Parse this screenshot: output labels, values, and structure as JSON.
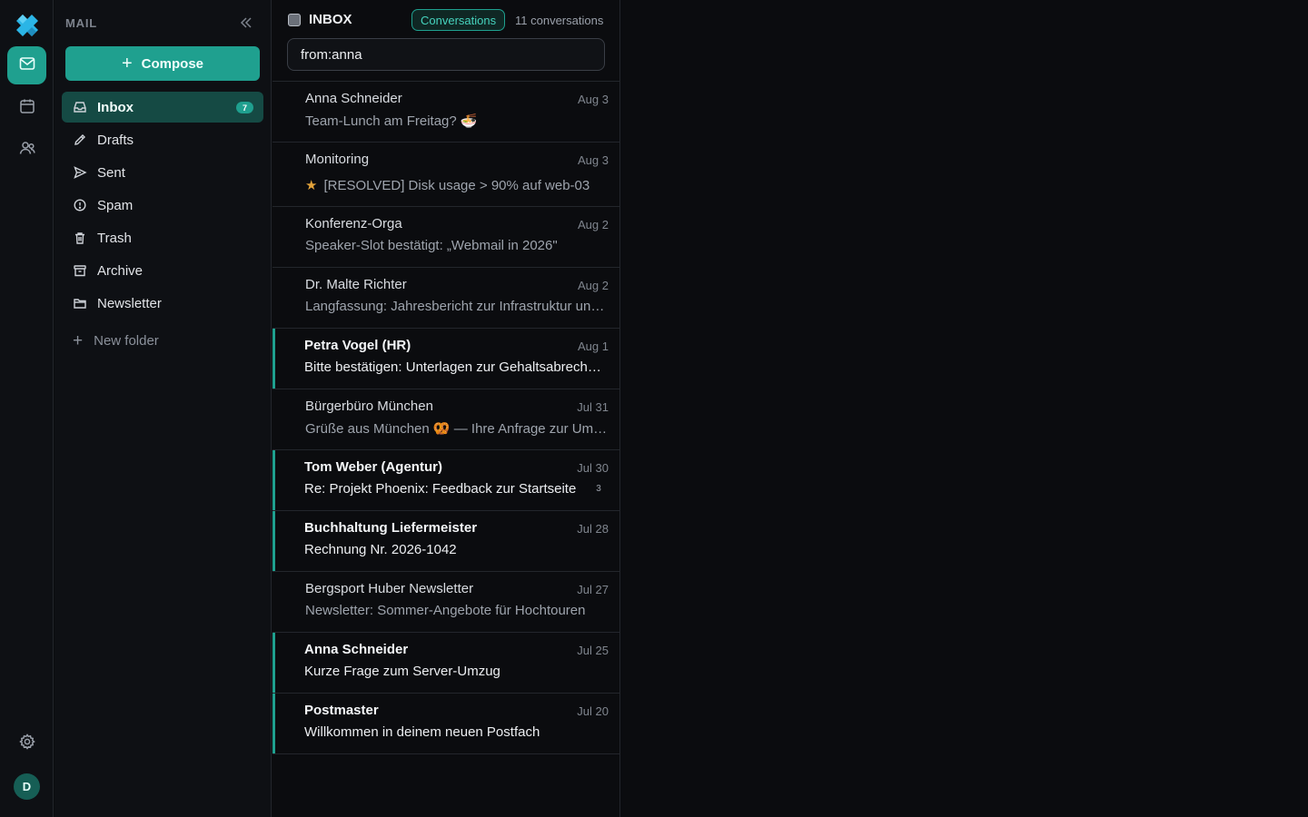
{
  "rail": {
    "logo": "app-logo",
    "items": [
      {
        "name": "mail",
        "icon": "mail-icon",
        "active": true
      },
      {
        "name": "calendar",
        "icon": "calendar-icon",
        "active": false
      },
      {
        "name": "contacts",
        "icon": "contacts-icon",
        "active": false
      }
    ],
    "settings_icon": "gear-icon",
    "avatar_initial": "D"
  },
  "folders_pane": {
    "title": "MAIL",
    "compose_label": "Compose",
    "folders": [
      {
        "label": "Inbox",
        "icon": "inbox-icon",
        "badge": "7",
        "active": true
      },
      {
        "label": "Drafts",
        "icon": "pencil-icon",
        "badge": "",
        "active": false
      },
      {
        "label": "Sent",
        "icon": "send-icon",
        "badge": "",
        "active": false
      },
      {
        "label": "Spam",
        "icon": "alert-circle-icon",
        "badge": "",
        "active": false
      },
      {
        "label": "Trash",
        "icon": "trash-icon",
        "badge": "",
        "active": false
      },
      {
        "label": "Archive",
        "icon": "archive-icon",
        "badge": "",
        "active": false
      },
      {
        "label": "Newsletter",
        "icon": "folder-icon",
        "badge": "",
        "active": false
      }
    ],
    "new_folder_label": "New folder"
  },
  "list": {
    "title": "INBOX",
    "view_mode": "Conversations",
    "count_label": "11 conversations",
    "search_value": "from:anna",
    "messages": [
      {
        "sender": "Anna Schneider",
        "date": "Aug 3",
        "subject": "Team-Lunch am Freitag? 🍜",
        "unread": false,
        "starred": false,
        "thread_count": ""
      },
      {
        "sender": "Monitoring",
        "date": "Aug 3",
        "subject": "[RESOLVED] Disk usage > 90% auf web-03",
        "unread": false,
        "starred": true,
        "thread_count": ""
      },
      {
        "sender": "Konferenz-Orga",
        "date": "Aug 2",
        "subject": "Speaker-Slot bestätigt: „Webmail in 2026\"",
        "unread": false,
        "starred": false,
        "thread_count": ""
      },
      {
        "sender": "Dr. Malte Richter",
        "date": "Aug 2",
        "subject": "Langfassung: Jahresbericht zur Infrastruktur und Betrieb",
        "unread": false,
        "starred": false,
        "thread_count": ""
      },
      {
        "sender": "Petra Vogel (HR)",
        "date": "Aug 1",
        "subject": "Bitte bestätigen: Unterlagen zur Gehaltsabrechnung",
        "unread": true,
        "starred": false,
        "thread_count": ""
      },
      {
        "sender": "Bürgerbüro München",
        "date": "Jul 31",
        "subject": "Grüße aus München 🥨 — Ihre Anfrage zur Ummeldung",
        "unread": false,
        "starred": false,
        "thread_count": ""
      },
      {
        "sender": "Tom Weber (Agentur)",
        "date": "Jul 30",
        "subject": "Re: Projekt Phoenix: Feedback zur Startseite",
        "unread": true,
        "starred": false,
        "thread_count": "3"
      },
      {
        "sender": "Buchhaltung Liefermeister",
        "date": "Jul 28",
        "subject": "Rechnung Nr. 2026-1042",
        "unread": true,
        "starred": false,
        "thread_count": ""
      },
      {
        "sender": "Bergsport Huber Newsletter",
        "date": "Jul 27",
        "subject": "Newsletter: Sommer-Angebote für Hochtouren",
        "unread": false,
        "starred": false,
        "thread_count": ""
      },
      {
        "sender": "Anna Schneider",
        "date": "Jul 25",
        "subject": "Kurze Frage zum Server-Umzug",
        "unread": true,
        "starred": false,
        "thread_count": ""
      },
      {
        "sender": "Postmaster",
        "date": "Jul 20",
        "subject": "Willkommen in deinem neuen Postfach",
        "unread": true,
        "starred": false,
        "thread_count": ""
      }
    ]
  },
  "colors": {
    "accent": "#1fa08f",
    "background": "#0b0c0f",
    "star": "#e3a33a"
  }
}
